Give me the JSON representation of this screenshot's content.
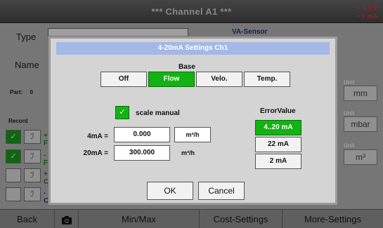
{
  "window": {
    "title": "*** Channel A1 ***",
    "status_voltage": "~ 0.0 V",
    "status_current": "~ 0 mA"
  },
  "background": {
    "type_label": "Type",
    "name_label": "Name",
    "va_sensor": "VA-Sensor",
    "part_label": "Part:",
    "part_value": "0",
    "record_label": "Record",
    "records": [
      "+ F",
      "- F",
      "+ C",
      "- C"
    ],
    "units": [
      {
        "label": "Unit",
        "value": "mm"
      },
      {
        "label": "Unit",
        "value": "mbar"
      },
      {
        "label": "Unit",
        "value": "m³"
      }
    ]
  },
  "bottom_bar": {
    "back": "Back",
    "camera_icon": "camera-icon",
    "minmax": "Min/Max",
    "cost_settings": "Cost-Settings",
    "more_settings": "More-Settings"
  },
  "dialog": {
    "title": "4-20mA Settings Ch1",
    "base_label": "Base",
    "base_options": [
      "Off",
      "Flow",
      "Velo.",
      "Temp."
    ],
    "base_selected": "Flow",
    "scale_manual_label": "scale manual",
    "scale_manual_checked": true,
    "ma4_label": "4mA =",
    "ma4_value": "0.000",
    "ma4_unit": "m³/h",
    "ma20_label": "20mA =",
    "ma20_value": "300.000",
    "ma20_unit": "m³/h",
    "error_label": "ErrorValue",
    "error_options": [
      "4..20 mA",
      "22 mA",
      "2 mA"
    ],
    "error_selected": "4..20 mA",
    "ok": "OK",
    "cancel": "Cancel"
  },
  "colors": {
    "accent_green": "#13b313",
    "title_bar_blue": "#a4b8e6",
    "status_red": "#ff3030"
  }
}
